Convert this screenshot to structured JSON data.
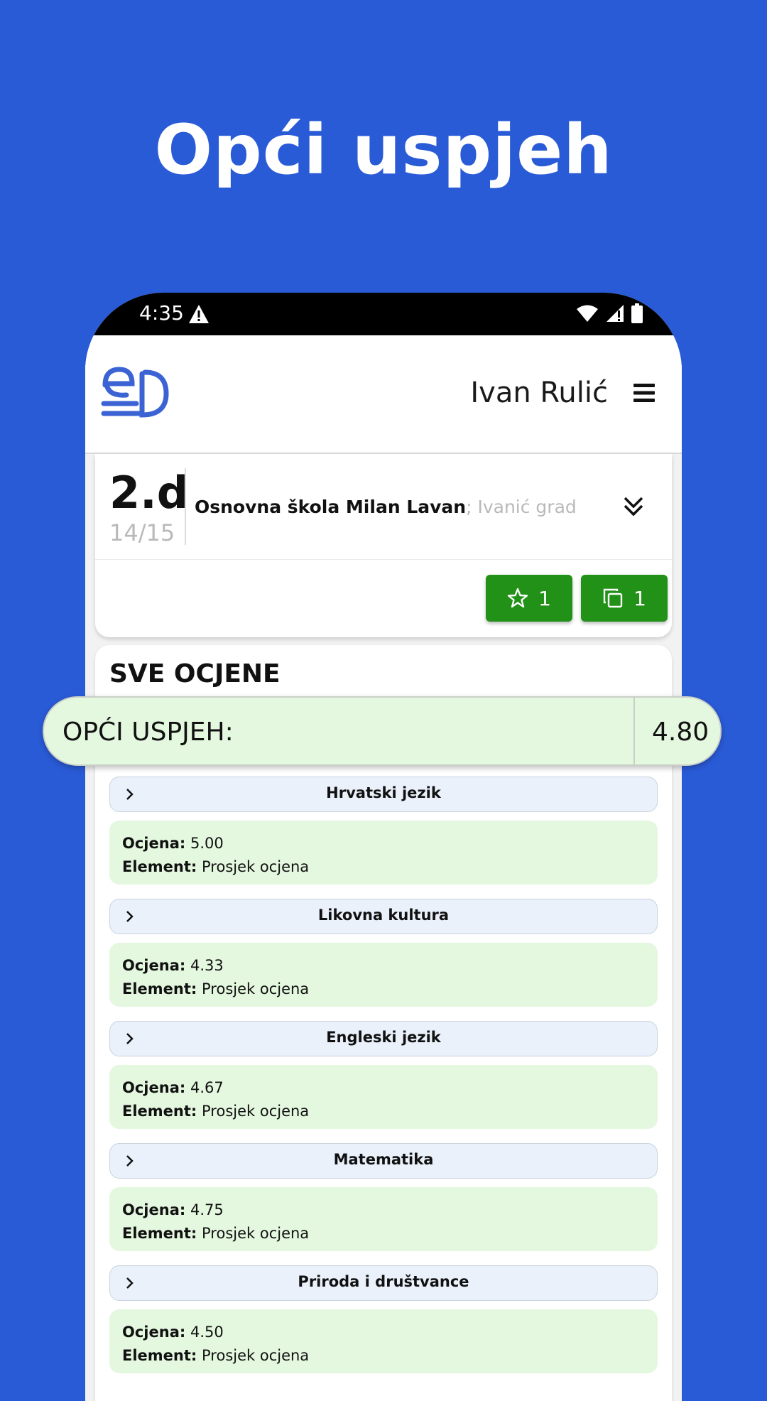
{
  "headline": "Opći uspjeh",
  "status_bar": {
    "time": "4:35"
  },
  "header": {
    "user_name": "Ivan Rulić"
  },
  "class_info": {
    "class_name": "2.d",
    "school_year": "14/15",
    "school_name": "Osnovna škola Milan Lavan",
    "school_city": "; Ivanić grad",
    "badges": [
      {
        "icon": "star-icon",
        "count": "1"
      },
      {
        "icon": "copy-icon",
        "count": "1"
      }
    ]
  },
  "grades": {
    "title": "SVE OCJENE",
    "overall_label": "OPĆI USPJEH:",
    "overall_value": "4.80",
    "grade_label": "Ocjena:",
    "element_label": "Element:",
    "subjects": [
      {
        "name": "Hrvatski jezik",
        "grade": "5.00",
        "element": "Prosjek ocjena"
      },
      {
        "name": "Likovna kultura",
        "grade": "4.33",
        "element": "Prosjek ocjena"
      },
      {
        "name": "Engleski jezik",
        "grade": "4.67",
        "element": "Prosjek ocjena"
      },
      {
        "name": "Matematika",
        "grade": "4.75",
        "element": "Prosjek ocjena"
      },
      {
        "name": "Priroda i društvance",
        "grade": "4.50",
        "element": "Prosjek ocjena"
      }
    ]
  },
  "colors": {
    "background": "#2a5bd7",
    "brand_blue": "#3b63d4",
    "badge_green": "#229117",
    "grade_bg": "#e4f7df",
    "subject_bg": "#eaf1fb"
  }
}
